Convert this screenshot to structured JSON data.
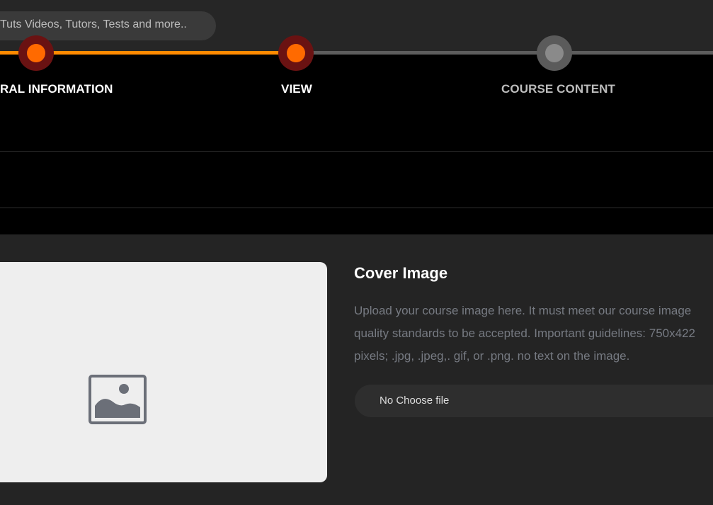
{
  "header": {
    "search_placeholder": "Tuts Videos, Tutors, Tests and more.."
  },
  "stepper": {
    "steps": [
      {
        "label": "RAL INFORMATION",
        "state": "complete"
      },
      {
        "label": "VIEW",
        "state": "complete"
      },
      {
        "label": "COURSE CONTENT",
        "state": "pending"
      }
    ],
    "colors": {
      "active": "#ff8a00",
      "inactive": "#5d5d5d"
    }
  },
  "cover": {
    "title": "Cover Image",
    "description": "Upload your course image here. It must meet our course image quality standards to be accepted. Important guidelines: 750x422 pixels; .jpg, .jpeg,. gif, or .png. no text on the image.",
    "file_label": "No Choose file",
    "placeholder_icon": "image-placeholder-icon"
  }
}
